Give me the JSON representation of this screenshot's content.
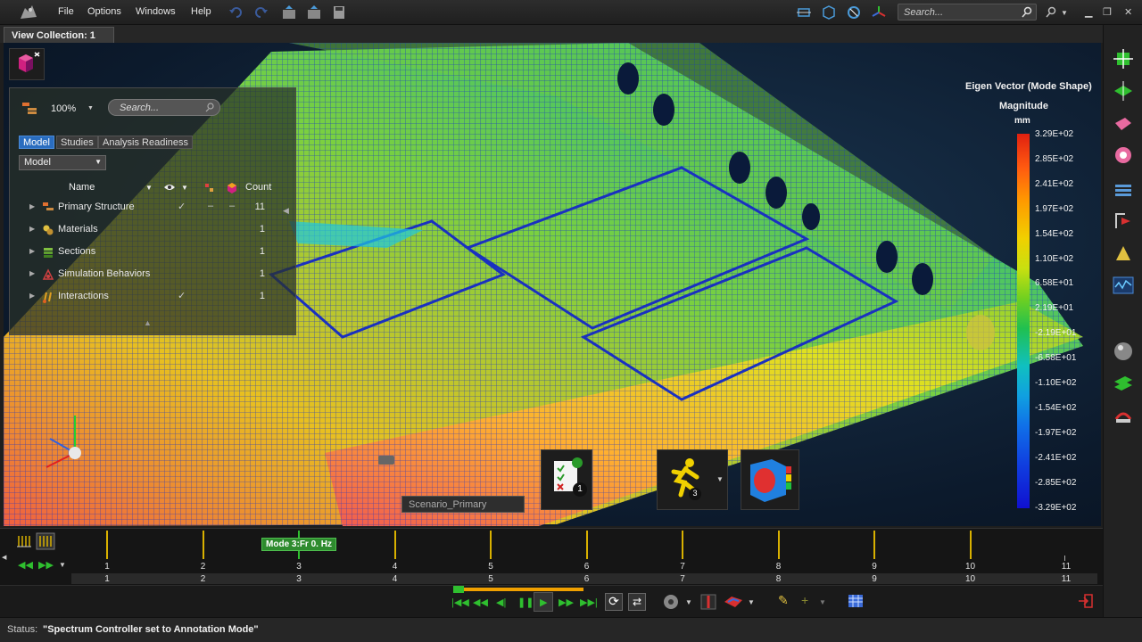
{
  "menu": {
    "file": "File",
    "options": "Options",
    "windows": "Windows",
    "help": "Help",
    "search_placeholder": "Search..."
  },
  "collection_tab": "View Collection: 1",
  "browser": {
    "zoom": "100%",
    "search_placeholder": "Search...",
    "tabs": [
      "Model",
      "Studies",
      "Analysis Readiness"
    ],
    "view_select": "Model",
    "columns": {
      "name": "Name",
      "count": "Count"
    },
    "rows": [
      {
        "label": "Primary Structure",
        "count": "11",
        "checked": "✓"
      },
      {
        "label": "Materials",
        "count": "1",
        "checked": ""
      },
      {
        "label": "Sections",
        "count": "1",
        "checked": ""
      },
      {
        "label": "Simulation Behaviors",
        "count": "1",
        "checked": ""
      },
      {
        "label": "Interactions",
        "count": "1",
        "checked": "✓"
      }
    ]
  },
  "legend": {
    "title": "Eigen Vector (Mode Shape)",
    "subtitle": "Magnitude",
    "unit": "mm",
    "labels": [
      "3.29E+02",
      "2.85E+02",
      "2.41E+02",
      "1.97E+02",
      "1.54E+02",
      "1.10E+02",
      "6.58E+01",
      "2.19E+01",
      "-2.19E+01",
      "-6.58E+01",
      "-1.10E+02",
      "-1.54E+02",
      "-1.97E+02",
      "-2.41E+02",
      "-2.85E+02",
      "-3.29E+02"
    ]
  },
  "scenario_label": "Scenario_Primary",
  "checklist_badge": "1",
  "run_badge": "3",
  "timeline": {
    "mode_badge": "Mode 3:Fr 0. Hz",
    "ticks": [
      "1",
      "2",
      "3",
      "4",
      "5",
      "6",
      "7",
      "8",
      "9",
      "10",
      "11"
    ]
  },
  "status": {
    "label": "Status:",
    "text": "\"Spectrum Controller set to Annotation Mode\""
  }
}
